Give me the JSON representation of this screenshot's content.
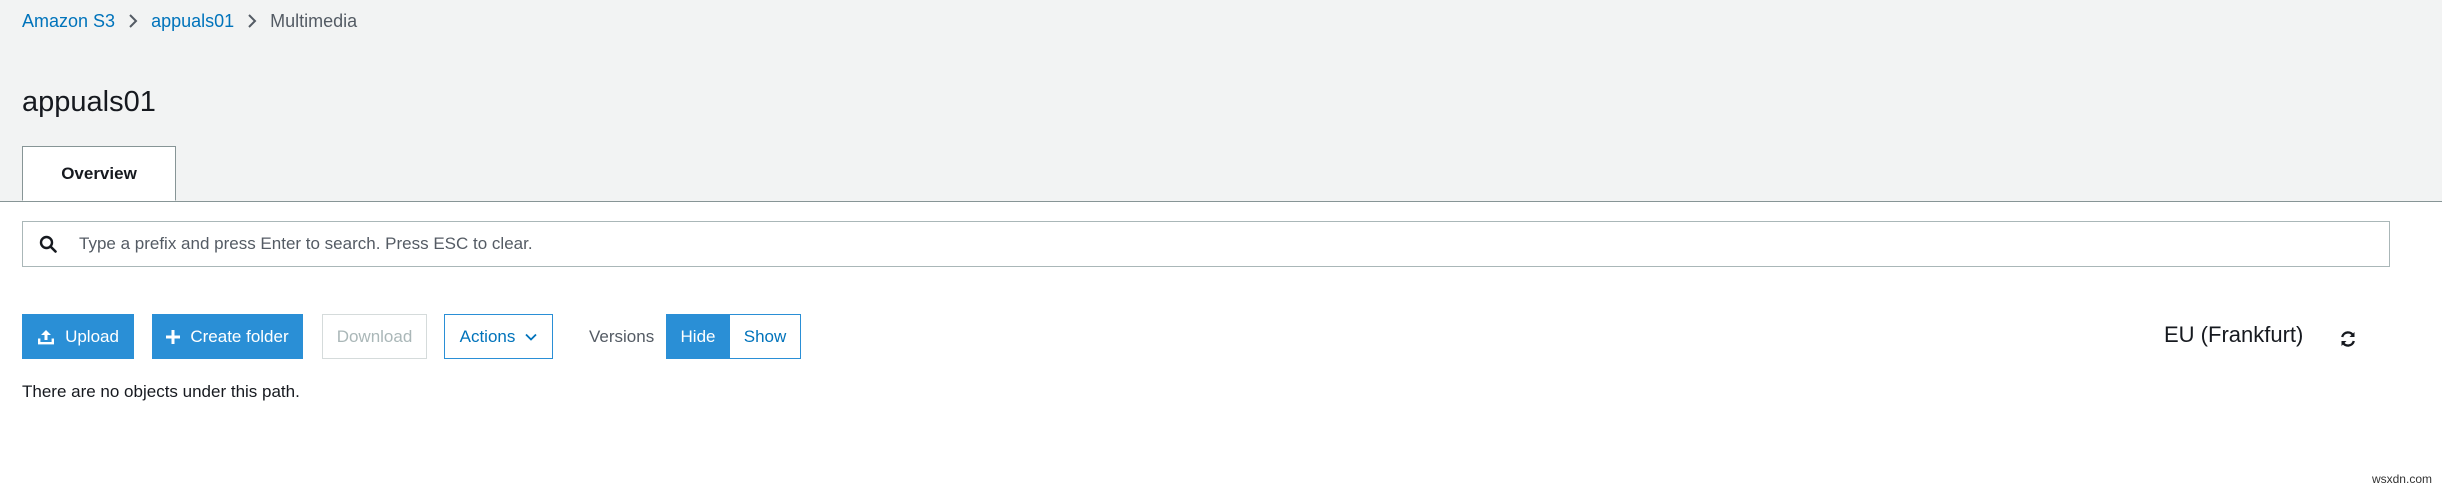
{
  "breadcrumb": {
    "items": [
      "Amazon S3",
      "appuals01"
    ],
    "current": "Multimedia"
  },
  "page": {
    "title": "appuals01"
  },
  "tabs": [
    {
      "label": "Overview",
      "active": true
    }
  ],
  "search": {
    "placeholder": "Type a prefix and press Enter to search. Press ESC to clear.",
    "value": ""
  },
  "toolbar": {
    "upload_label": "Upload",
    "create_folder_label": "Create folder",
    "download_label": "Download",
    "actions_label": "Actions",
    "versions_label": "Versions",
    "versions_hide_label": "Hide",
    "versions_show_label": "Show",
    "versions_selected": "Hide"
  },
  "region": {
    "label": "EU (Frankfurt)"
  },
  "content": {
    "empty_message": "There are no objects under this path."
  },
  "watermark": "wsxdn.com",
  "colors": {
    "accent": "#2a8fd6",
    "link": "#0073bb",
    "header_bg": "#f2f3f3"
  },
  "icons": {
    "search": "search-icon",
    "upload": "upload-icon",
    "create_folder": "plus-icon",
    "actions": "chevron-down-icon",
    "refresh": "refresh-icon",
    "breadcrumb_separator": "chevron-right-icon"
  }
}
